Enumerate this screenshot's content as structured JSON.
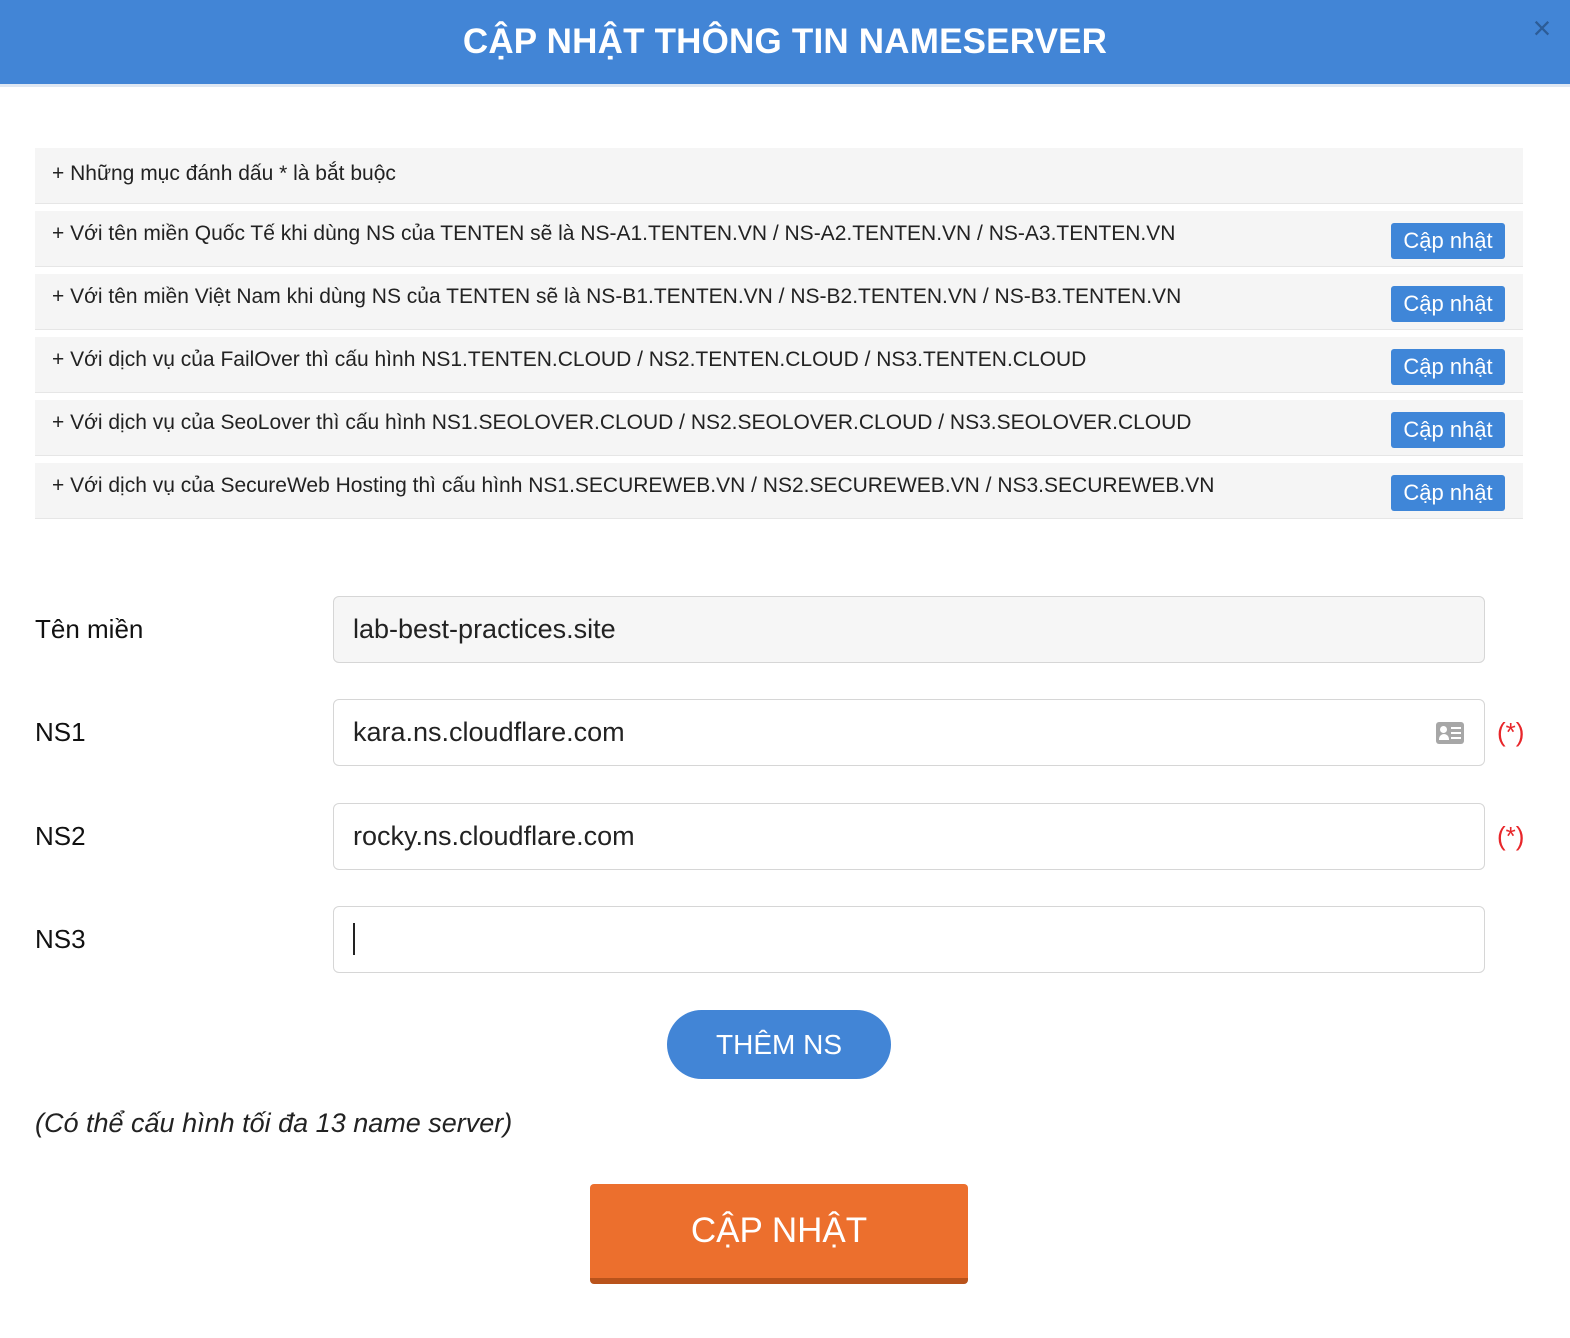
{
  "header": {
    "title": "CẬP NHẬT THÔNG TIN NAMESERVER",
    "close_symbol": "×"
  },
  "notes": [
    {
      "text": "+ Những mục đánh dấu * là bắt buộc"
    },
    {
      "text": "+ Với tên miền Quốc Tế khi dùng NS của TENTEN sẽ là NS-A1.TENTEN.VN / NS-A2.TENTEN.VN / NS-A3.TENTEN.VN",
      "button": "Cập nhật"
    },
    {
      "text": "+ Với tên miền Việt Nam khi dùng NS của TENTEN sẽ là NS-B1.TENTEN.VN / NS-B2.TENTEN.VN / NS-B3.TENTEN.VN",
      "button": "Cập nhật"
    },
    {
      "text": "+ Với dịch vụ của FailOver thì cấu hình NS1.TENTEN.CLOUD / NS2.TENTEN.CLOUD / NS3.TENTEN.CLOUD",
      "button": "Cập nhật"
    },
    {
      "text": "+ Với dịch vụ của SeoLover thì cấu hình NS1.SEOLOVER.CLOUD / NS2.SEOLOVER.CLOUD / NS3.SEOLOVER.CLOUD",
      "button": "Cập nhật"
    },
    {
      "text": "+ Với dịch vụ của SecureWeb Hosting thì cấu hình NS1.SECUREWEB.VN / NS2.SECUREWEB.VN / NS3.SECUREWEB.VN",
      "button": "Cập nhật"
    }
  ],
  "form": {
    "domain": {
      "label": "Tên miền",
      "value": "lab-best-practices.site"
    },
    "ns1": {
      "label": "NS1",
      "value": "kara.ns.cloudflare.com",
      "required": "(*)"
    },
    "ns2": {
      "label": "NS2",
      "value": "rocky.ns.cloudflare.com",
      "required": "(*)"
    },
    "ns3": {
      "label": "NS3",
      "value": ""
    }
  },
  "add_ns_button": "THÊM NS",
  "max_note": "(Có thể cấu hình tối đa 13 name server)",
  "submit_button": "CẬP NHẬT",
  "icons": {
    "close": "close-icon",
    "contact_card": "contact-card-icon"
  },
  "colors": {
    "header": "#4285d6",
    "submit": "#ec6f2d",
    "required": "#e8262a"
  }
}
